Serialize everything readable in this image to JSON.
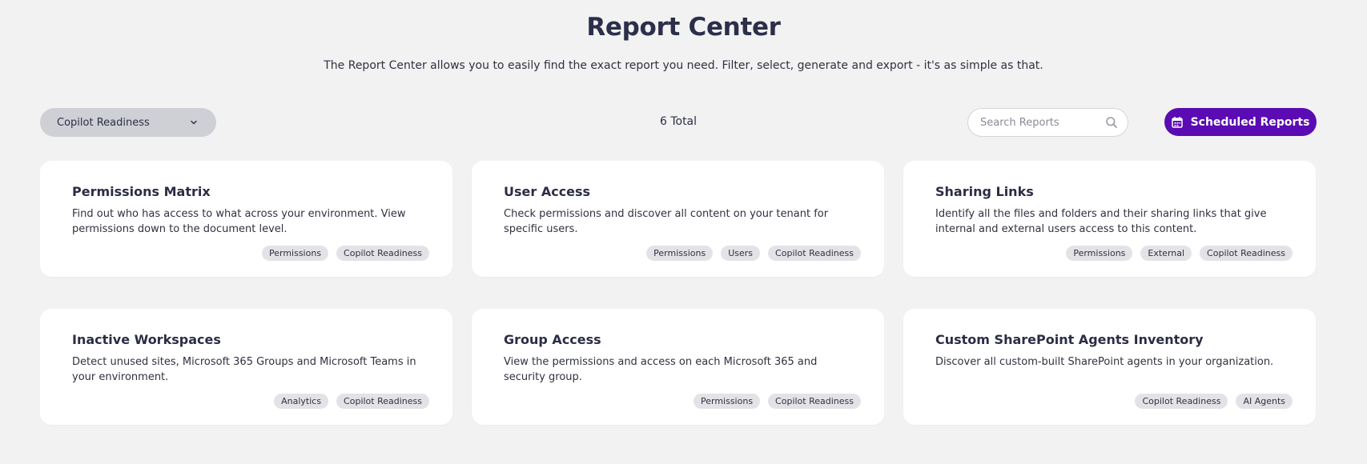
{
  "header": {
    "title": "Report Center",
    "subtitle": "The Report Center allows you to easily find the exact report you need. Filter, select, generate and export - it's as simple as that."
  },
  "toolbar": {
    "filter_value": "Copilot Readiness",
    "total": "6 Total",
    "search_placeholder": "Search Reports",
    "scheduled_label": "Scheduled Reports"
  },
  "colors": {
    "accent": "#5a0bb3",
    "background": "#f2f2f2"
  },
  "reports": [
    {
      "title": "Permissions Matrix",
      "description": "Find out who has access to what across your environment. View permissions down to the document level.",
      "tags": [
        "Permissions",
        "Copilot Readiness"
      ]
    },
    {
      "title": "User Access",
      "description": "Check permissions and discover all content on your tenant for specific users.",
      "tags": [
        "Permissions",
        "Users",
        "Copilot Readiness"
      ]
    },
    {
      "title": "Sharing Links",
      "description": "Identify all the files and folders and their sharing links that give internal and external users access to this content.",
      "tags": [
        "Permissions",
        "External",
        "Copilot Readiness"
      ]
    },
    {
      "title": "Inactive Workspaces",
      "description": "Detect unused sites, Microsoft 365 Groups and Microsoft Teams in your environment.",
      "tags": [
        "Analytics",
        "Copilot Readiness"
      ]
    },
    {
      "title": "Group Access",
      "description": "View the permissions and access on each Microsoft 365 and security group.",
      "tags": [
        "Permissions",
        "Copilot Readiness"
      ]
    },
    {
      "title": "Custom SharePoint Agents Inventory",
      "description": "Discover all custom-built SharePoint agents in your organization.",
      "tags": [
        "Copilot Readiness",
        "AI Agents"
      ]
    }
  ]
}
